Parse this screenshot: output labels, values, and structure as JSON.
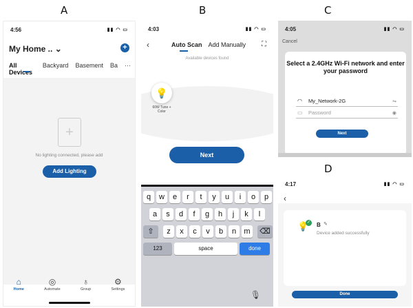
{
  "letters": [
    "A",
    "B",
    "C",
    "D"
  ],
  "accent_color": "#1a5fa8",
  "panel_a": {
    "time": "4:56",
    "home_title": "My Home ..",
    "tabs": [
      "All Devices",
      "Backyard",
      "Basement",
      "Ba"
    ],
    "more": "···",
    "empty_text": "No lighting connected, please add",
    "add_button": "Add Lighting",
    "nav": [
      {
        "label": "Home",
        "icon": "home-icon"
      },
      {
        "label": "Automate",
        "icon": "automate-icon"
      },
      {
        "label": "Group",
        "icon": "group-icon"
      },
      {
        "label": "Settings",
        "icon": "gear-icon"
      }
    ]
  },
  "panel_b": {
    "time": "4:03",
    "tabs": [
      "Auto Scan",
      "Add Manually"
    ],
    "available": "Available devices found",
    "bulb_label": "60W Tune + Color",
    "next": "Next",
    "keys_row1": [
      "q",
      "w",
      "e",
      "r",
      "t",
      "y",
      "u",
      "i",
      "o",
      "p"
    ],
    "keys_row2": [
      "a",
      "s",
      "d",
      "f",
      "g",
      "h",
      "j",
      "k",
      "l"
    ],
    "keys_row3": [
      "z",
      "x",
      "c",
      "v",
      "b",
      "n",
      "m"
    ],
    "key_123": "123",
    "key_space": "space",
    "key_done": "done"
  },
  "panel_c": {
    "time": "4:05",
    "cancel": "Cancel",
    "heading": "Select a 2.4GHz Wi-Fi network and enter your password",
    "network": "My_Network-2G",
    "password_placeholder": "Password",
    "next": "Next"
  },
  "panel_d": {
    "time": "4:17",
    "device_name": "B",
    "message": "Device added successfully",
    "done": "Done"
  }
}
